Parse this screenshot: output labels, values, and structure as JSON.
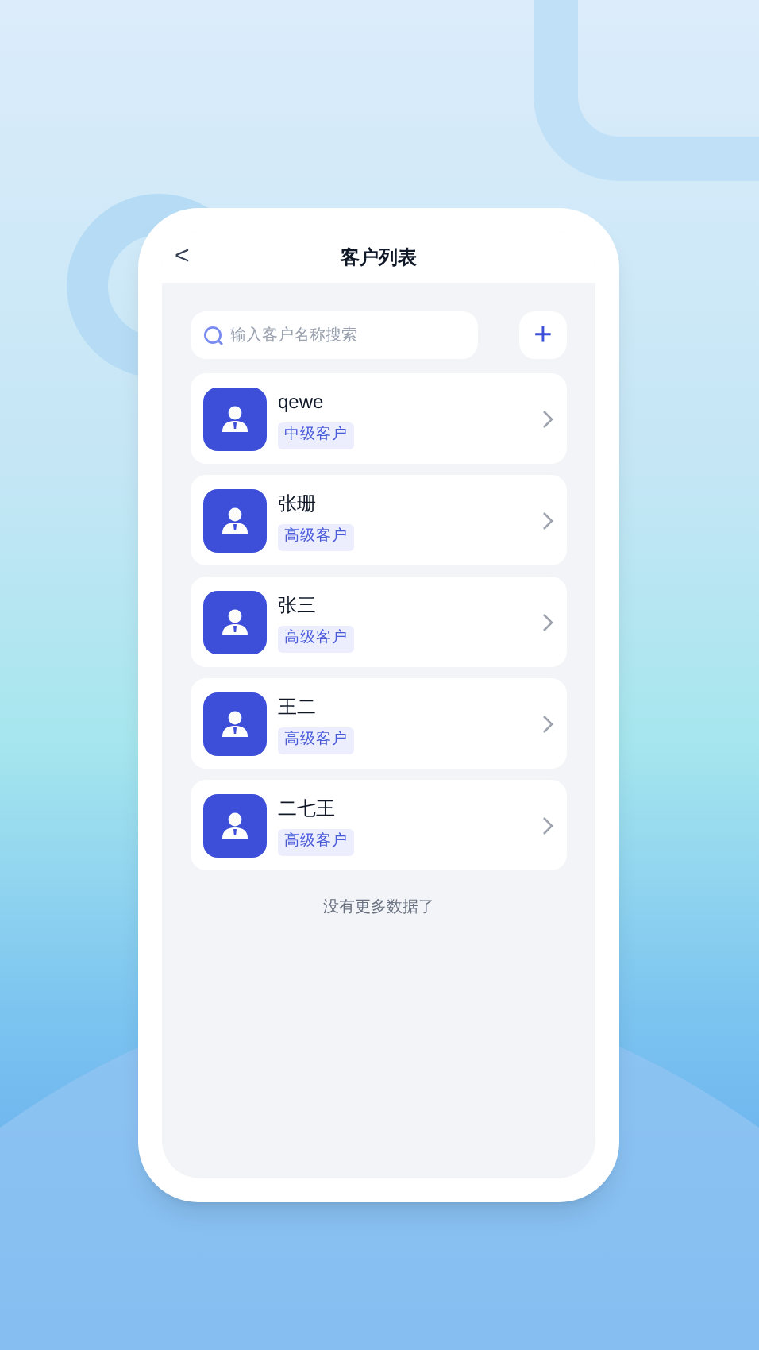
{
  "header": {
    "back": "<",
    "title": "客户列表"
  },
  "search": {
    "placeholder": "输入客户名称搜索"
  },
  "add_button": "+",
  "customers": [
    {
      "name": "qewe",
      "tag": "中级客户"
    },
    {
      "name": "张珊",
      "tag": "高级客户"
    },
    {
      "name": "张三",
      "tag": "高级客户"
    },
    {
      "name": "王二",
      "tag": "高级客户"
    },
    {
      "name": "二七王",
      "tag": "高级客户"
    }
  ],
  "footer": "没有更多数据了"
}
